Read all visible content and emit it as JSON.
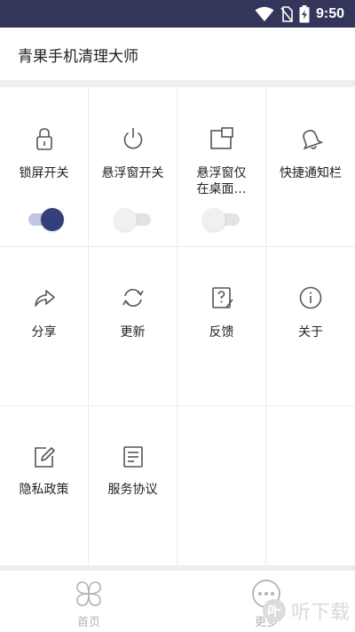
{
  "status_bar": {
    "time": "9:50",
    "icons": [
      "wifi-icon",
      "sim-no-signal-icon",
      "battery-charging-icon"
    ],
    "background": "#33365a"
  },
  "header": {
    "title": "青果手机清理大师"
  },
  "grid": {
    "toggles_row": [
      {
        "label": "锁屏开关",
        "icon": "lock-icon",
        "toggle_on": true
      },
      {
        "label": "悬浮窗开关",
        "icon": "power-icon",
        "toggle_on": false
      },
      {
        "label_line1": "悬浮窗仅",
        "label_line2": "在桌面…",
        "icon": "floating-window-icon",
        "toggle_on": false
      },
      {
        "label": "快捷通知栏",
        "icon": "bell-icon"
      }
    ],
    "actions_row": [
      {
        "label": "分享",
        "icon": "share-icon"
      },
      {
        "label": "更新",
        "icon": "refresh-icon"
      },
      {
        "label": "反馈",
        "icon": "feedback-icon"
      },
      {
        "label": "关于",
        "icon": "info-icon"
      }
    ],
    "legal_row": [
      {
        "label": "隐私政策",
        "icon": "edit-document-icon"
      },
      {
        "label": "服务协议",
        "icon": "document-icon"
      }
    ]
  },
  "bottom_nav": {
    "items": [
      {
        "label": "首页",
        "icon": "home-clover-icon"
      },
      {
        "label": "更多",
        "icon": "more-dots-icon"
      }
    ]
  },
  "watermark": {
    "text": "听下载"
  },
  "colors": {
    "accent": "#33407a",
    "toggle_track_on": "#c3c6e0",
    "icon_gray": "#555555"
  }
}
